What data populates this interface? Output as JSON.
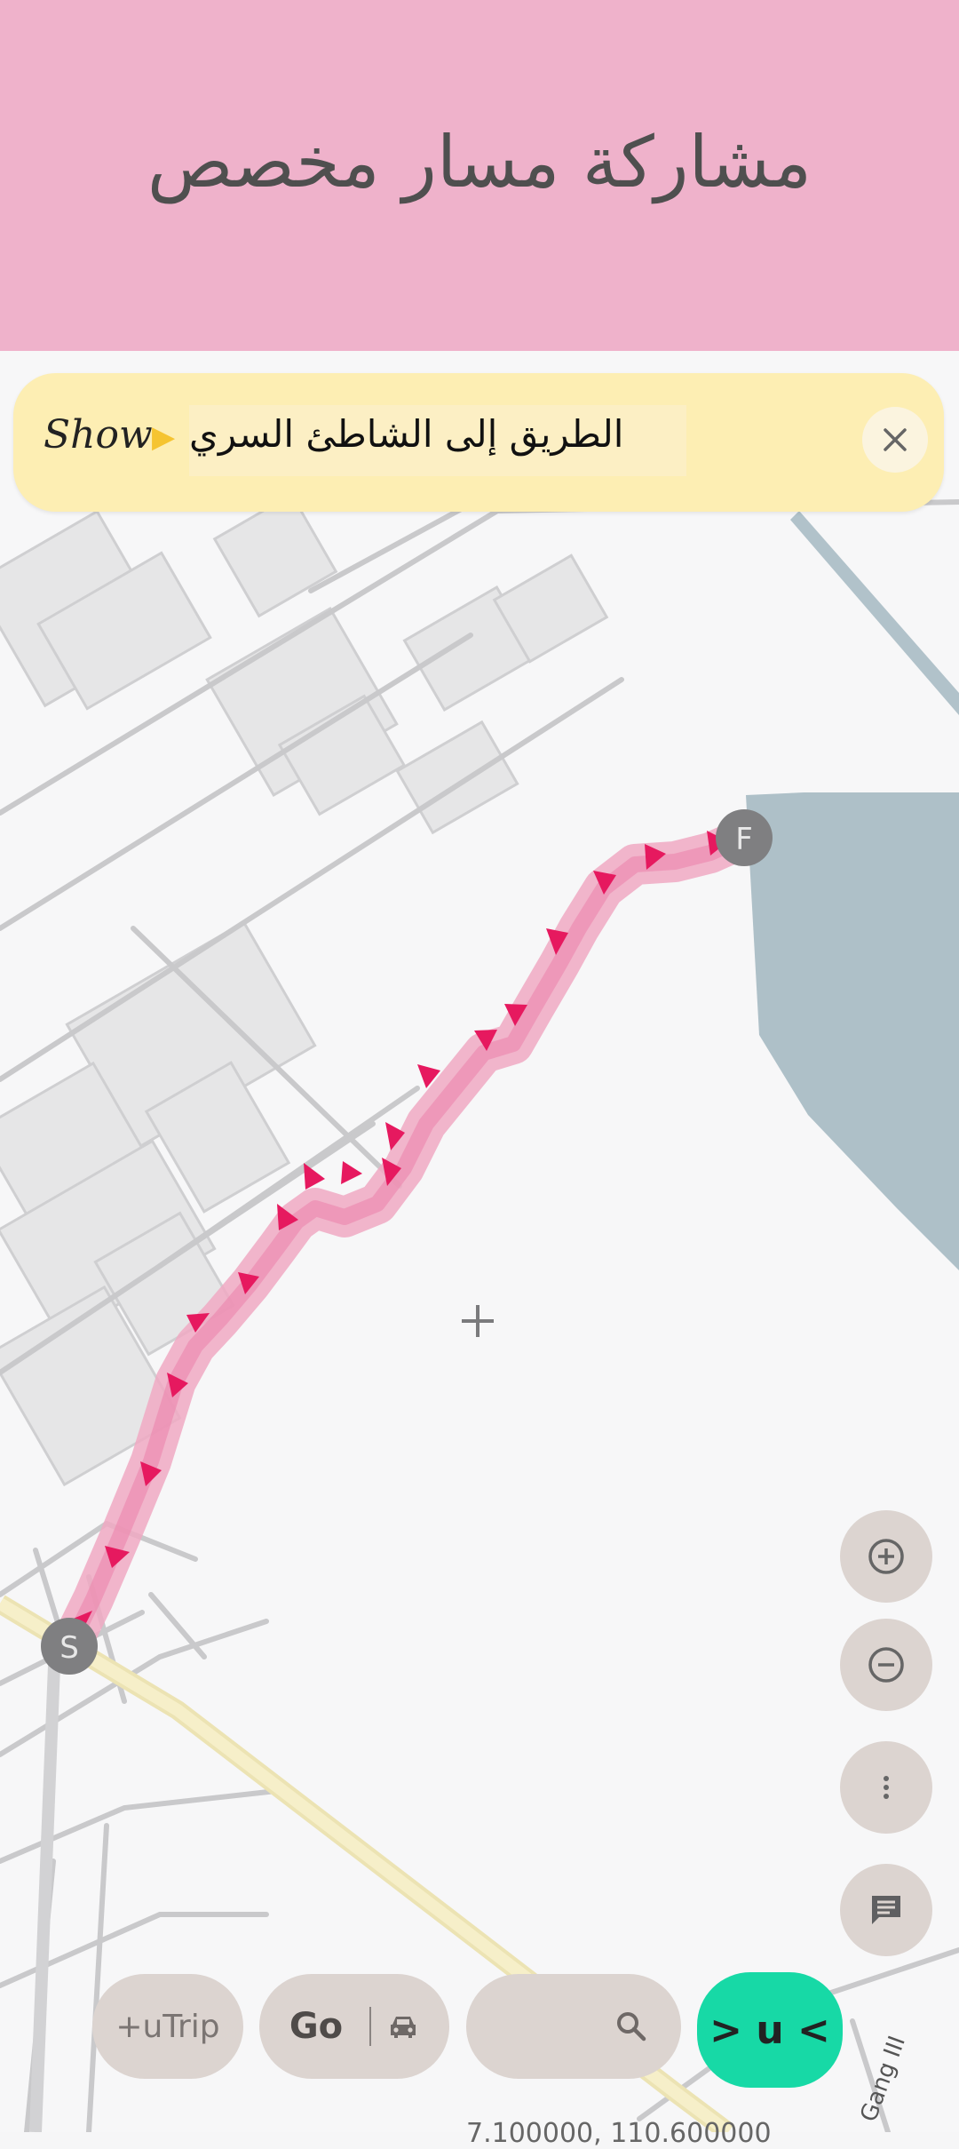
{
  "header": {
    "title": "مشاركة مسار مخصص"
  },
  "banner": {
    "show_label": "Show",
    "arrow": "▶",
    "route_name": "الطريق إلى الشاطئ السري",
    "close_icon": "close-icon"
  },
  "map": {
    "start_marker": "S",
    "finish_marker": "F",
    "road_label": "Gang III",
    "crosshair_icon": "plus-icon",
    "coordinates": "7.100000, 110.600000"
  },
  "side_controls": {
    "zoom_in_icon": "zoom-in-icon",
    "zoom_out_icon": "zoom-out-icon",
    "more_icon": "more-vertical-icon",
    "chat_icon": "chat-icon"
  },
  "bottom_bar": {
    "trip_label": "+uTrip",
    "go_label": "Go",
    "car_icon": "car-icon",
    "search_icon": "search-icon",
    "compass_label": "> u <"
  },
  "colors": {
    "header_bg": "#efb2cb",
    "banner_bg": "#fdeeb3",
    "route": "#e6195f",
    "water": "#aec0c8",
    "accent": "#17d9a6"
  }
}
